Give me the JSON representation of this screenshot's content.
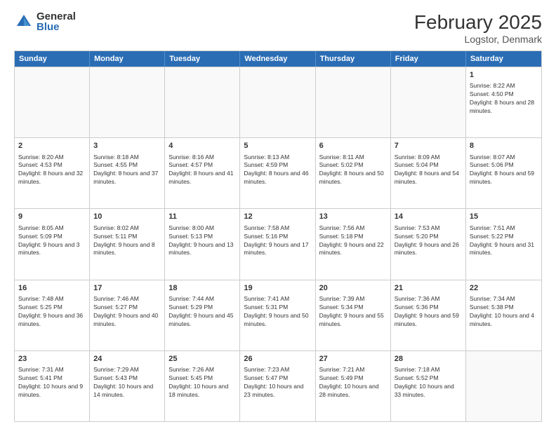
{
  "header": {
    "logo_general": "General",
    "logo_blue": "Blue",
    "main_title": "February 2025",
    "subtitle": "Logstor, Denmark"
  },
  "days": [
    "Sunday",
    "Monday",
    "Tuesday",
    "Wednesday",
    "Thursday",
    "Friday",
    "Saturday"
  ],
  "weeks": [
    [
      {
        "day": "",
        "empty": true,
        "lines": []
      },
      {
        "day": "",
        "empty": true,
        "lines": []
      },
      {
        "day": "",
        "empty": true,
        "lines": []
      },
      {
        "day": "",
        "empty": true,
        "lines": []
      },
      {
        "day": "",
        "empty": true,
        "lines": []
      },
      {
        "day": "",
        "empty": true,
        "lines": []
      },
      {
        "day": "1",
        "lines": [
          "Sunrise: 8:22 AM",
          "Sunset: 4:50 PM",
          "Daylight: 8 hours and 28 minutes."
        ]
      }
    ],
    [
      {
        "day": "2",
        "lines": [
          "Sunrise: 8:20 AM",
          "Sunset: 4:53 PM",
          "Daylight: 8 hours and 32 minutes."
        ]
      },
      {
        "day": "3",
        "lines": [
          "Sunrise: 8:18 AM",
          "Sunset: 4:55 PM",
          "Daylight: 8 hours and 37 minutes."
        ]
      },
      {
        "day": "4",
        "lines": [
          "Sunrise: 8:16 AM",
          "Sunset: 4:57 PM",
          "Daylight: 8 hours and 41 minutes."
        ]
      },
      {
        "day": "5",
        "lines": [
          "Sunrise: 8:13 AM",
          "Sunset: 4:59 PM",
          "Daylight: 8 hours and 46 minutes."
        ]
      },
      {
        "day": "6",
        "lines": [
          "Sunrise: 8:11 AM",
          "Sunset: 5:02 PM",
          "Daylight: 8 hours and 50 minutes."
        ]
      },
      {
        "day": "7",
        "lines": [
          "Sunrise: 8:09 AM",
          "Sunset: 5:04 PM",
          "Daylight: 8 hours and 54 minutes."
        ]
      },
      {
        "day": "8",
        "lines": [
          "Sunrise: 8:07 AM",
          "Sunset: 5:06 PM",
          "Daylight: 8 hours and 59 minutes."
        ]
      }
    ],
    [
      {
        "day": "9",
        "lines": [
          "Sunrise: 8:05 AM",
          "Sunset: 5:09 PM",
          "Daylight: 9 hours and 3 minutes."
        ]
      },
      {
        "day": "10",
        "lines": [
          "Sunrise: 8:02 AM",
          "Sunset: 5:11 PM",
          "Daylight: 9 hours and 8 minutes."
        ]
      },
      {
        "day": "11",
        "lines": [
          "Sunrise: 8:00 AM",
          "Sunset: 5:13 PM",
          "Daylight: 9 hours and 13 minutes."
        ]
      },
      {
        "day": "12",
        "lines": [
          "Sunrise: 7:58 AM",
          "Sunset: 5:16 PM",
          "Daylight: 9 hours and 17 minutes."
        ]
      },
      {
        "day": "13",
        "lines": [
          "Sunrise: 7:56 AM",
          "Sunset: 5:18 PM",
          "Daylight: 9 hours and 22 minutes."
        ]
      },
      {
        "day": "14",
        "lines": [
          "Sunrise: 7:53 AM",
          "Sunset: 5:20 PM",
          "Daylight: 9 hours and 26 minutes."
        ]
      },
      {
        "day": "15",
        "lines": [
          "Sunrise: 7:51 AM",
          "Sunset: 5:22 PM",
          "Daylight: 9 hours and 31 minutes."
        ]
      }
    ],
    [
      {
        "day": "16",
        "lines": [
          "Sunrise: 7:48 AM",
          "Sunset: 5:25 PM",
          "Daylight: 9 hours and 36 minutes."
        ]
      },
      {
        "day": "17",
        "lines": [
          "Sunrise: 7:46 AM",
          "Sunset: 5:27 PM",
          "Daylight: 9 hours and 40 minutes."
        ]
      },
      {
        "day": "18",
        "lines": [
          "Sunrise: 7:44 AM",
          "Sunset: 5:29 PM",
          "Daylight: 9 hours and 45 minutes."
        ]
      },
      {
        "day": "19",
        "lines": [
          "Sunrise: 7:41 AM",
          "Sunset: 5:31 PM",
          "Daylight: 9 hours and 50 minutes."
        ]
      },
      {
        "day": "20",
        "lines": [
          "Sunrise: 7:39 AM",
          "Sunset: 5:34 PM",
          "Daylight: 9 hours and 55 minutes."
        ]
      },
      {
        "day": "21",
        "lines": [
          "Sunrise: 7:36 AM",
          "Sunset: 5:36 PM",
          "Daylight: 9 hours and 59 minutes."
        ]
      },
      {
        "day": "22",
        "lines": [
          "Sunrise: 7:34 AM",
          "Sunset: 5:38 PM",
          "Daylight: 10 hours and 4 minutes."
        ]
      }
    ],
    [
      {
        "day": "23",
        "lines": [
          "Sunrise: 7:31 AM",
          "Sunset: 5:41 PM",
          "Daylight: 10 hours and 9 minutes."
        ]
      },
      {
        "day": "24",
        "lines": [
          "Sunrise: 7:29 AM",
          "Sunset: 5:43 PM",
          "Daylight: 10 hours and 14 minutes."
        ]
      },
      {
        "day": "25",
        "lines": [
          "Sunrise: 7:26 AM",
          "Sunset: 5:45 PM",
          "Daylight: 10 hours and 18 minutes."
        ]
      },
      {
        "day": "26",
        "lines": [
          "Sunrise: 7:23 AM",
          "Sunset: 5:47 PM",
          "Daylight: 10 hours and 23 minutes."
        ]
      },
      {
        "day": "27",
        "lines": [
          "Sunrise: 7:21 AM",
          "Sunset: 5:49 PM",
          "Daylight: 10 hours and 28 minutes."
        ]
      },
      {
        "day": "28",
        "lines": [
          "Sunrise: 7:18 AM",
          "Sunset: 5:52 PM",
          "Daylight: 10 hours and 33 minutes."
        ]
      },
      {
        "day": "",
        "empty": true,
        "lines": []
      }
    ]
  ]
}
